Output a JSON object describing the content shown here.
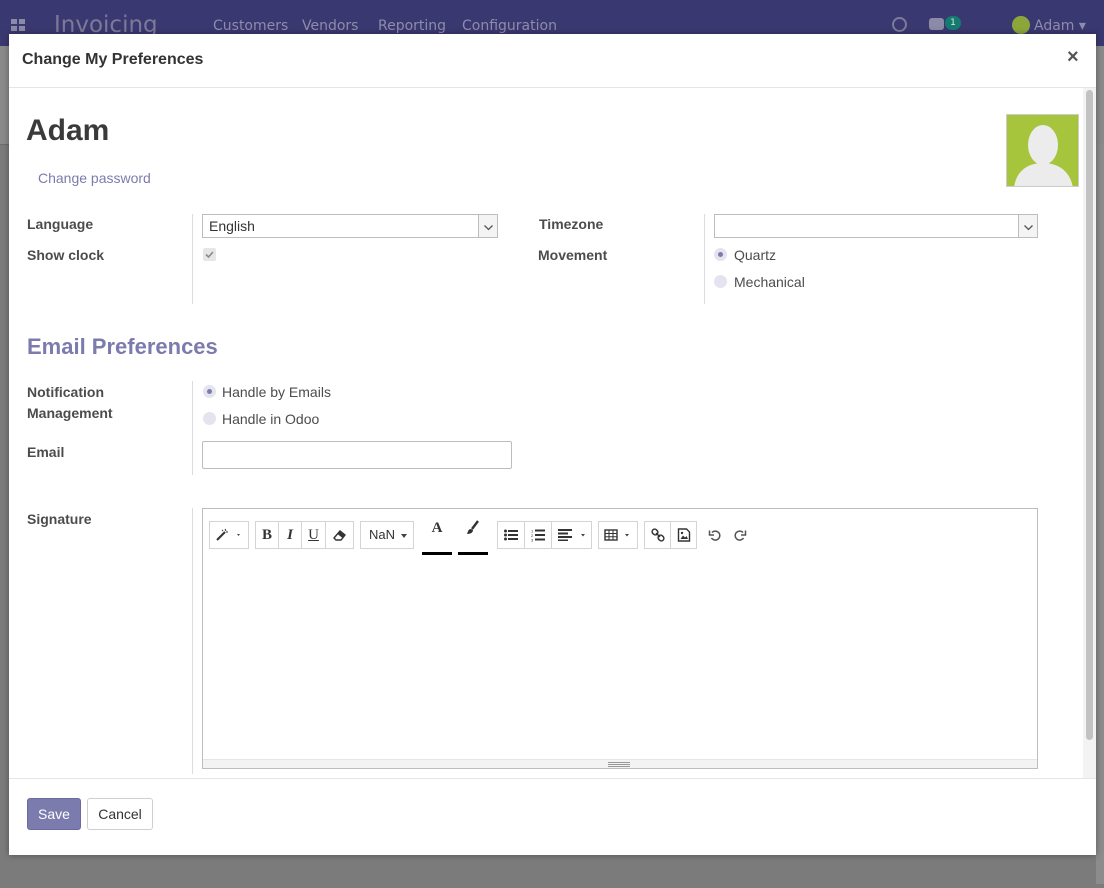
{
  "app": {
    "title": "Invoicing",
    "menu": [
      "Customers",
      "Vendors",
      "Reporting",
      "Configuration"
    ],
    "messages_badge": "1",
    "user_name": "Adam"
  },
  "modal": {
    "title": "Change My Preferences",
    "close_glyph": "×"
  },
  "user": {
    "name": "Adam",
    "change_password_label": "Change password"
  },
  "prefs": {
    "language_label": "Language",
    "language_value": "English",
    "show_clock_label": "Show clock",
    "show_clock_checked": true,
    "timezone_label": "Timezone",
    "timezone_value": "",
    "movement_label": "Movement",
    "movement_options": [
      "Quartz",
      "Mechanical"
    ],
    "movement_selected": "Quartz"
  },
  "email_prefs": {
    "section_title": "Email Preferences",
    "notification_label_line1": "Notification",
    "notification_label_line2": "Management",
    "notification_options": [
      "Handle by Emails",
      "Handle in Odoo"
    ],
    "notification_selected": "Handle by Emails",
    "email_label": "Email",
    "email_value": "",
    "signature_label": "Signature"
  },
  "editor": {
    "font_size_label": "NaN",
    "bold_label": "B",
    "italic_label": "I",
    "underline_label": "U",
    "font_color_label": "A",
    "toolbar_icons": [
      "magic-wand-icon",
      "bold-icon",
      "italic-icon",
      "underline-icon",
      "eraser-icon",
      "font-size-dropdown",
      "font-color-icon",
      "paint-brush-icon",
      "unordered-list-icon",
      "ordered-list-icon",
      "align-icon",
      "table-icon",
      "link-icon",
      "image-icon",
      "undo-icon",
      "redo-icon"
    ],
    "content": ""
  },
  "footer": {
    "save_label": "Save",
    "cancel_label": "Cancel"
  },
  "colors": {
    "brand_purple": "#7c7bad",
    "navbar": "#3a3870",
    "avatar_green": "#a7c53c"
  }
}
